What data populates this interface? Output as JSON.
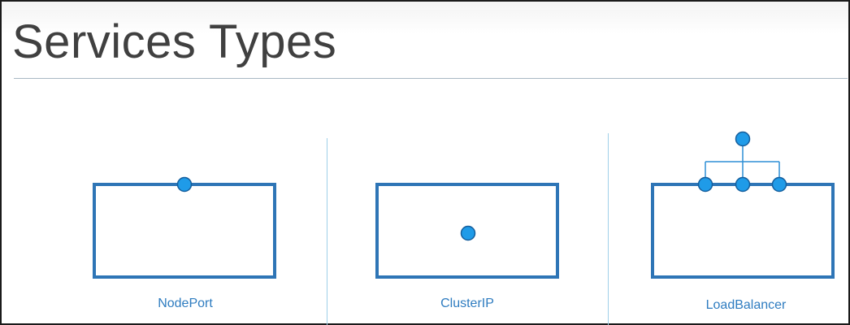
{
  "title": "Services Types",
  "colors": {
    "box_stroke": "#2e75b6",
    "port_fill": "#1f9be8",
    "port_stroke": "#155e9c",
    "connector": "#2e8fd6",
    "label": "#2e7cc0",
    "divider": "#9fd0e8",
    "title": "#404040"
  },
  "service_types": [
    {
      "label": "NodePort",
      "ports": "one-on-top-edge"
    },
    {
      "label": "ClusterIP",
      "ports": "one-inside"
    },
    {
      "label": "LoadBalancer",
      "ports": "three-on-top-edge-joined-to-one-above"
    }
  ]
}
